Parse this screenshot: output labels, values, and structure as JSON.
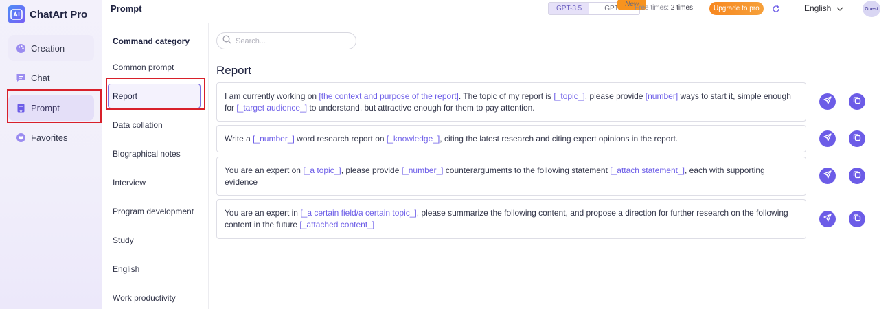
{
  "app": {
    "name": "ChatArt Pro"
  },
  "sidebar": {
    "items": [
      {
        "label": "Creation",
        "icon": "palette-icon"
      },
      {
        "label": "Chat",
        "icon": "chat-icon"
      },
      {
        "label": "Prompt",
        "icon": "prompt-book-icon"
      },
      {
        "label": "Favorites",
        "icon": "heart-icon"
      }
    ]
  },
  "header": {
    "title": "Prompt",
    "models": [
      "GPT-3.5",
      "GPT-4"
    ],
    "new_badge": "New",
    "free_times_label": "Free times:",
    "free_times_value": "2 times",
    "upgrade_label": "Upgrade to pro",
    "language": "English",
    "user": "Guest"
  },
  "categories": {
    "heading": "Command category",
    "items": [
      "Common prompt",
      "Report",
      "Data collation",
      "Biographical notes",
      "Interview",
      "Program development",
      "Study",
      "English",
      "Work productivity"
    ],
    "selected": "Report"
  },
  "search": {
    "placeholder": "Search..."
  },
  "main": {
    "section_title": "Report",
    "prompts": [
      {
        "t0": "I am currently working on ",
        "p0": "[the context and purpose of the report]",
        "t1": ". The topic of my report is ",
        "p1": "[_topic_]",
        "t2": ", please provide ",
        "p2": "[number]",
        "t3": " ways to start it, simple enough for ",
        "p3": "[_target audience_]",
        "t4": " to understand, but attractive enough for them to pay attention."
      },
      {
        "t0": "Write a ",
        "p0": "[_number_]",
        "t1": " word research report on ",
        "p1": "[_knowledge_]",
        "t2": ", citing the latest research and citing expert opinions in the report."
      },
      {
        "t0": "You are an expert on ",
        "p0": "[_a topic_]",
        "t1": ", please provide ",
        "p1": "[_number_]",
        "t2": " counterarguments to the following statement ",
        "p2": "[_attach statement_]",
        "t3": ", each with supporting evidence"
      },
      {
        "t0": "You are an expert in ",
        "p0": "[_a certain field/a certain topic_]",
        "t1": ", please summarize the following content, and propose a direction for further research on the following content in the future ",
        "p1": "[_attached content_]"
      }
    ]
  },
  "colors": {
    "accent": "#6c5ce7",
    "placeholder_text": "#6e5fe8",
    "upgrade": "#f7931e",
    "highlight": "#d8202a"
  }
}
